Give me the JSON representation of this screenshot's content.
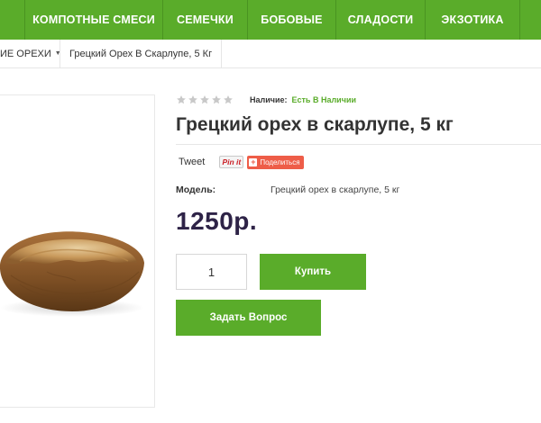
{
  "nav": {
    "items": [
      {
        "label": ""
      },
      {
        "label": "КОМПОТНЫЕ СМЕСИ"
      },
      {
        "label": "СЕМЕЧКИ"
      },
      {
        "label": "БОБОВЫЕ"
      },
      {
        "label": "СЛАДОСТИ"
      },
      {
        "label": "ЭКЗОТИКА"
      },
      {
        "label": ""
      }
    ]
  },
  "breadcrumb": {
    "parent": "ИЕ ОРЕХИ",
    "current": "Грецкий Орех В Скарлупе, 5 Кг"
  },
  "product": {
    "rating_stars": 5,
    "rating_filled": 0,
    "availability_label": "Наличие:",
    "availability_value": "Есть В Наличии",
    "title": "Грецкий орех в скарлупе, 5 кг",
    "model_label": "Модель:",
    "model_value": "Грецкий орех в скарлупе, 5 кг",
    "price": "1250р.",
    "quantity": "1"
  },
  "social": {
    "tweet": "Tweet",
    "pinit": "Pin it",
    "share": "Поделиться"
  },
  "actions": {
    "buy": "Купить",
    "ask": "Задать Вопрос"
  },
  "colors": {
    "brand_green": "#5aac2a",
    "price": "#2e2347",
    "availability": "#5aac2a",
    "share": "#ee5d48"
  }
}
